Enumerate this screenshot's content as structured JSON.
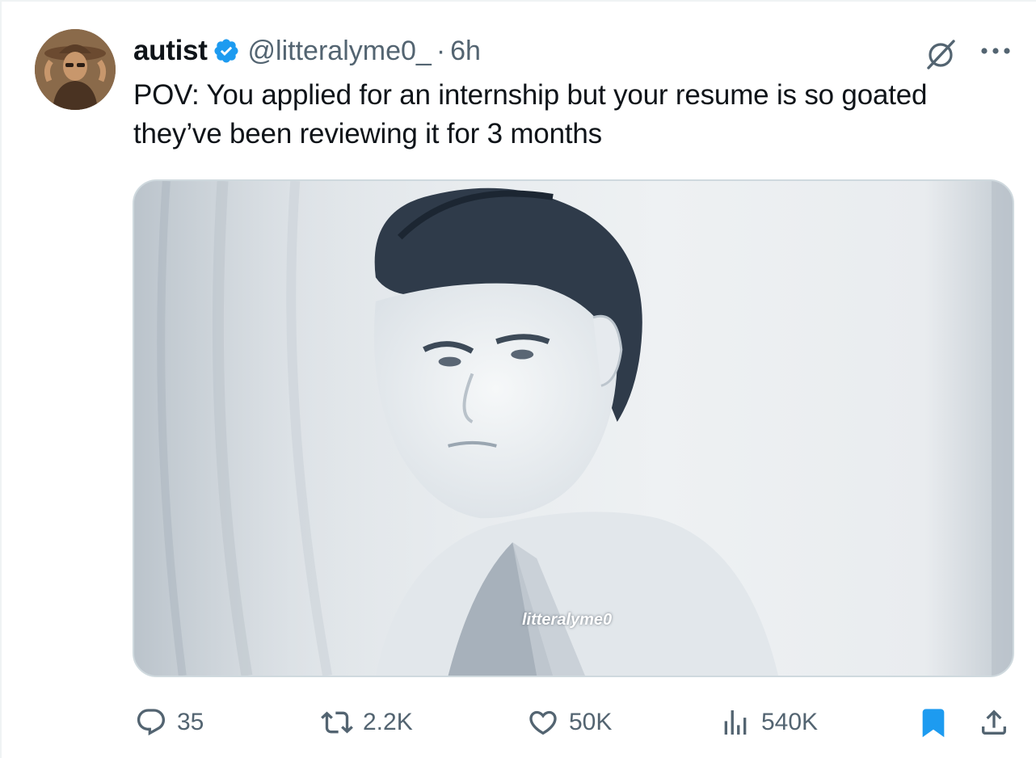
{
  "tweet": {
    "author_name": "autist",
    "handle": "@litteralyme0_",
    "separator": "·",
    "time": "6h",
    "text_lines": [
      "POV: You applied for an internship but your resume is so goated",
      "they’ve been reviewing it for 3 months"
    ],
    "media_watermark": "litteralyme0"
  },
  "actions": {
    "replies": "35",
    "retweets": "2.2K",
    "likes": "50K",
    "views": "540K"
  },
  "icons": {
    "verified": "verified-badge-icon",
    "grok": "grok-icon",
    "more": "more-icon",
    "reply": "reply-icon",
    "retweet": "retweet-icon",
    "like": "heart-icon",
    "views": "views-icon",
    "bookmark": "bookmark-icon",
    "share": "share-icon"
  },
  "colors": {
    "verified_blue": "#1d9bf0",
    "secondary_text": "#536471",
    "bookmark_active": "#1d9bf0"
  }
}
